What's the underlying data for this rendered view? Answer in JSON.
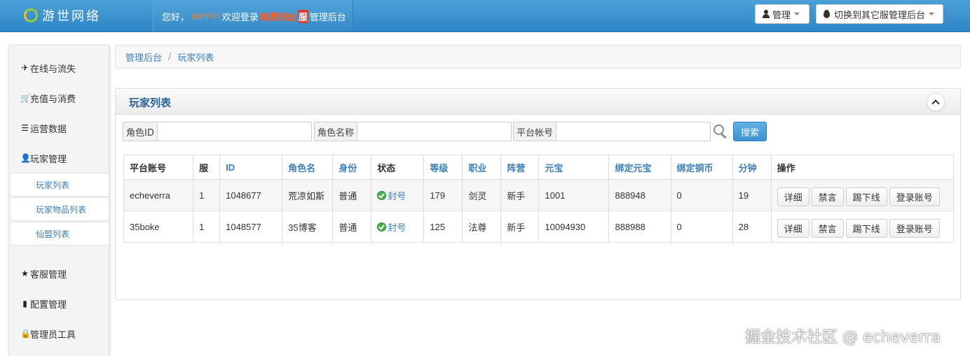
{
  "header": {
    "logo_text": "游世网络",
    "welcome_prefix": "您好，",
    "username": "admin",
    "welcome_mid": "欢迎登录",
    "server_name": "暗黑修仙",
    "server_badge": "服",
    "welcome_suffix": "管理后台",
    "admin_button": "管理",
    "switch_button": "切换到其它服管理后台"
  },
  "sidebar": {
    "items": [
      {
        "label": "在线与流失",
        "icon": "plane-icon",
        "glyph": "✈"
      },
      {
        "label": "充值与消费",
        "icon": "cart-icon",
        "glyph": "🛒"
      },
      {
        "label": "运营数据",
        "icon": "list-icon",
        "glyph": "☰"
      },
      {
        "label": "玩家管理",
        "icon": "user-icon",
        "glyph": "👤"
      },
      {
        "label": "客服管理",
        "icon": "star-icon",
        "glyph": "★"
      },
      {
        "label": "配置管理",
        "icon": "book-icon",
        "glyph": "▮"
      },
      {
        "label": "管理员工具",
        "icon": "lock-icon",
        "glyph": "🔒"
      }
    ],
    "sub_items": [
      {
        "label": "玩家列表"
      },
      {
        "label": "玩家物品列表"
      },
      {
        "label": "仙盟列表"
      }
    ]
  },
  "breadcrumb": [
    "管理后台",
    "玩家列表"
  ],
  "breadcrumb_sep": "/",
  "panel": {
    "title": "玩家列表",
    "search": {
      "role_id_label": "角色ID",
      "role_name_label": "角色名称",
      "platform_account_label": "平台帐号",
      "button": "搜索"
    }
  },
  "table": {
    "headers": [
      "平台账号",
      "服",
      "ID",
      "角色名",
      "身份",
      "状态",
      "等级",
      "职业",
      "阵营",
      "元宝",
      "绑定元宝",
      "绑定铜币",
      "分钟",
      "操作"
    ],
    "rows": [
      {
        "account": "echeverra",
        "server": "1",
        "id": "1048677",
        "name": "荒凉如斯",
        "identity": "普通",
        "status": "封号",
        "level": "179",
        "job": "剑灵",
        "camp": "新手",
        "yuanbao": "1001",
        "bound_yuanbao": "888948",
        "bound_copper": "0",
        "minutes": "19"
      },
      {
        "account": "35boke",
        "server": "1",
        "id": "1048577",
        "name": "35博客",
        "identity": "普通",
        "status": "封号",
        "level": "125",
        "job": "法尊",
        "camp": "新手",
        "yuanbao": "10094930",
        "bound_yuanbao": "888988",
        "bound_copper": "0",
        "minutes": "28"
      }
    ],
    "actions": [
      "详细",
      "禁言",
      "踢下线",
      "登录账号"
    ]
  },
  "watermark": "掘金技术社区 @ echeverra"
}
